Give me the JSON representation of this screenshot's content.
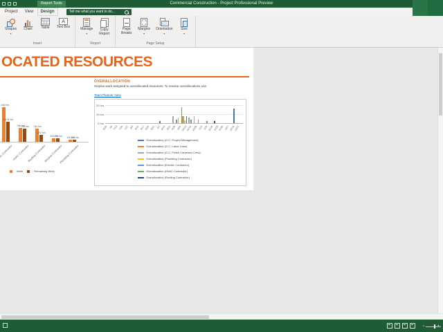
{
  "titlebar": {
    "title": "Commercial Construction - Project Professional Preview",
    "contextual_tab_group": "Report Tools",
    "qat_icons": [
      "save-icon",
      "undo-icon",
      "redo-icon"
    ]
  },
  "ribbon": {
    "tabs": [
      {
        "label": "Project",
        "active": false
      },
      {
        "label": "View",
        "active": false
      },
      {
        "label": "Design",
        "active": true
      }
    ],
    "search": {
      "text": "Tell me what you want to do...",
      "icon": "search-icon"
    },
    "groups": [
      {
        "label": "Insert",
        "items": [
          {
            "label": "Shapes",
            "icon": "shapes-icon",
            "dropdown": true
          },
          {
            "label": "Chart",
            "icon": "chart-icon",
            "dropdown": false
          },
          {
            "label": "Table",
            "icon": "table-icon",
            "dropdown": false
          },
          {
            "label": "Text Box",
            "icon": "textbox-icon",
            "dropdown": false
          }
        ]
      },
      {
        "label": "Report",
        "items": [
          {
            "label": "Manage",
            "icon": "manage-icon",
            "dropdown": true
          },
          {
            "label": "Copy\nReport",
            "icon": "copy-report-icon",
            "dropdown": false
          }
        ]
      },
      {
        "label": "Page Setup",
        "items": [
          {
            "label": "Page\nBreaks",
            "icon": "page-breaks-icon",
            "dropdown": false
          },
          {
            "label": "Margins",
            "icon": "margins-icon",
            "dropdown": true
          },
          {
            "label": "Orientation",
            "icon": "orientation-icon",
            "dropdown": true
          },
          {
            "label": "Size",
            "icon": "size-icon",
            "dropdown": true
          }
        ]
      }
    ]
  },
  "report": {
    "heading": "OCATED RESOURCES",
    "accent_color": "#E8641A",
    "overallocation_panel": {
      "title": "OVERALLOCATION",
      "description": "Surplus work assigned to overallocated resources. To resolve overallocations use:",
      "link": "Team Planner View"
    }
  },
  "chart_data": [
    {
      "type": "bar",
      "title": "",
      "categories": [
        "Electric Contractor",
        "HVAC Contractor",
        "Roofing Contractor",
        "Window Contractor",
        "Plumbing Contractor"
      ],
      "series": [
        {
          "name": "Work",
          "color": "#ED7D31",
          "values": [
            1920,
            768,
            744,
            200,
            120
          ]
        },
        {
          "name": "Remaining Work",
          "color": "#9E480E",
          "values": [
            1104,
            720,
            392,
            176,
            120
          ]
        }
      ],
      "value_label_suffix": " hrs",
      "ylim": [
        0,
        2000
      ],
      "legend_position": "bottom"
    },
    {
      "type": "bar",
      "title": "",
      "x": [
        "6/29",
        "7/6",
        "7/13",
        "7/20",
        "7/27",
        "8/3",
        "8/10",
        "8/17",
        "8/24",
        "8/31",
        "9/7",
        "9/14",
        "9/21",
        "9/28",
        "10/5",
        "10/12",
        "10/19",
        "10/26",
        "11/2",
        "11/9",
        "11/16",
        "11/23",
        "11/30",
        "12/7",
        "12/14",
        "12/21"
      ],
      "y_ticks": [
        "20 hrs",
        "10 hrs",
        "0 hrs"
      ],
      "ylim": [
        0,
        20
      ],
      "series": [
        {
          "name": "Overallocation (G.C. Project Management)",
          "color": "#4472C4",
          "points": [
            [
              "9/14",
              2
            ],
            [
              "10/19",
              8
            ],
            [
              "12/21",
              16
            ]
          ]
        },
        {
          "name": "Overallocation (G.C. Labor Crew)",
          "color": "#ED7D31",
          "points": [
            [
              "10/12",
              8
            ],
            [
              "11/2",
              4
            ]
          ]
        },
        {
          "name": "Overallocation (G.C. Finish Carpenter Crew)",
          "color": "#A5A5A5",
          "points": [
            [
              "9/28",
              8
            ],
            [
              "10/5",
              6
            ],
            [
              "10/12",
              8
            ],
            [
              "10/19",
              6
            ],
            [
              "10/26",
              8
            ]
          ]
        },
        {
          "name": "Overallocation (Plumbing Contractor)",
          "color": "#FFC000",
          "points": [
            [
              "10/12",
              3
            ]
          ]
        },
        {
          "name": "Overallocation (Electric Contractor)",
          "color": "#5B9BD5",
          "points": [
            [
              "10/19",
              4
            ],
            [
              "11/9",
              2
            ]
          ]
        },
        {
          "name": "Overallocation (HVAC Contractor)",
          "color": "#70AD47",
          "points": [
            [
              "9/28",
              4
            ],
            [
              "10/5",
              18
            ]
          ]
        },
        {
          "name": "Overallocation (Roofing Contractor)",
          "color": "#264478",
          "points": [
            [
              "11/16",
              2
            ]
          ]
        }
      ],
      "legend_position": "bottom"
    }
  ],
  "statusbar": {
    "view_icons": [
      "gantt-chart-view-icon",
      "task-usage-view-icon",
      "team-planner-view-icon",
      "report-view-icon"
    ]
  }
}
